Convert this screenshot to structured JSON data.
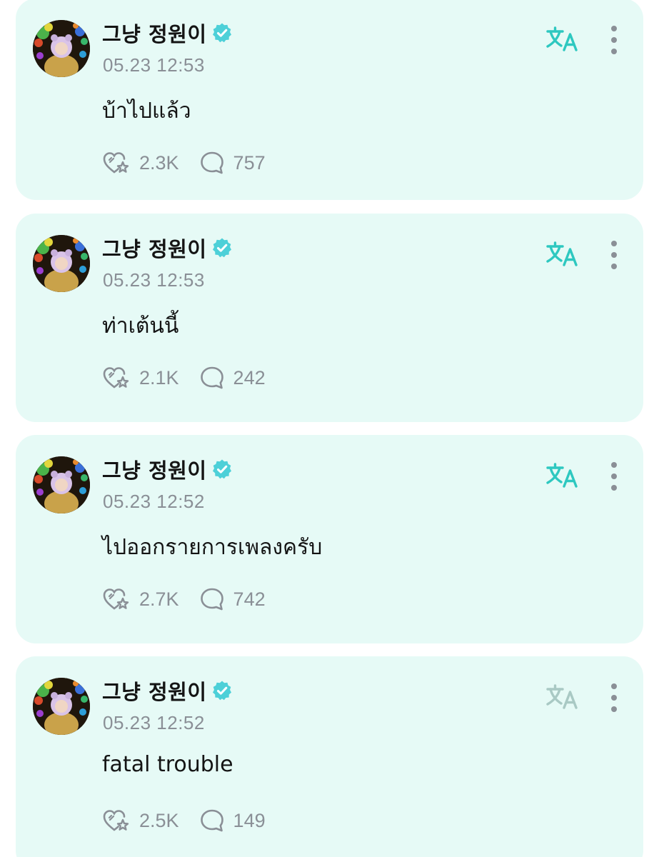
{
  "colors": {
    "card_bg": "#e6faf6",
    "accent": "#2ec8c0",
    "verified": "#4dd0d8",
    "muted": "#8a8f96"
  },
  "icons": {
    "verified": "verified-badge-icon",
    "translate": "translate-icon",
    "more": "more-vertical-icon",
    "heart": "heart-star-icon",
    "comment": "comment-bubble-icon"
  },
  "posts": [
    {
      "author": "그냥 정원이",
      "time": "05.23 12:53",
      "text": "บ้าไปแล้ว",
      "likes": "2.3K",
      "comments": "757",
      "translate_active": true
    },
    {
      "author": "그냥 정원이",
      "time": "05.23 12:53",
      "text": "ท่าเต้นนี้",
      "likes": "2.1K",
      "comments": "242",
      "translate_active": true
    },
    {
      "author": "그냥 정원이",
      "time": "05.23 12:52",
      "text": "ไปออกรายการเพลงครับ",
      "likes": "2.7K",
      "comments": "742",
      "translate_active": true
    },
    {
      "author": "그냥 정원이",
      "time": "05.23 12:52",
      "text": "fatal trouble",
      "likes": "2.5K",
      "comments": "149",
      "translate_active": false
    }
  ]
}
